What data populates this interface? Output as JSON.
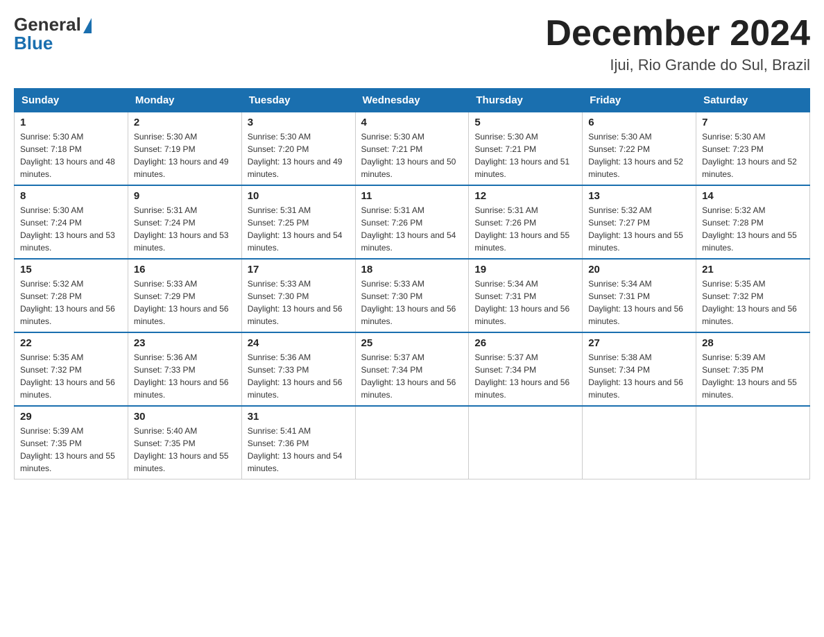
{
  "logo": {
    "general": "General",
    "blue": "Blue"
  },
  "title": "December 2024",
  "location": "Ijui, Rio Grande do Sul, Brazil",
  "headers": [
    "Sunday",
    "Monday",
    "Tuesday",
    "Wednesday",
    "Thursday",
    "Friday",
    "Saturday"
  ],
  "weeks": [
    [
      {
        "day": "1",
        "sunrise": "5:30 AM",
        "sunset": "7:18 PM",
        "daylight": "13 hours and 48 minutes."
      },
      {
        "day": "2",
        "sunrise": "5:30 AM",
        "sunset": "7:19 PM",
        "daylight": "13 hours and 49 minutes."
      },
      {
        "day": "3",
        "sunrise": "5:30 AM",
        "sunset": "7:20 PM",
        "daylight": "13 hours and 49 minutes."
      },
      {
        "day": "4",
        "sunrise": "5:30 AM",
        "sunset": "7:21 PM",
        "daylight": "13 hours and 50 minutes."
      },
      {
        "day": "5",
        "sunrise": "5:30 AM",
        "sunset": "7:21 PM",
        "daylight": "13 hours and 51 minutes."
      },
      {
        "day": "6",
        "sunrise": "5:30 AM",
        "sunset": "7:22 PM",
        "daylight": "13 hours and 52 minutes."
      },
      {
        "day": "7",
        "sunrise": "5:30 AM",
        "sunset": "7:23 PM",
        "daylight": "13 hours and 52 minutes."
      }
    ],
    [
      {
        "day": "8",
        "sunrise": "5:30 AM",
        "sunset": "7:24 PM",
        "daylight": "13 hours and 53 minutes."
      },
      {
        "day": "9",
        "sunrise": "5:31 AM",
        "sunset": "7:24 PM",
        "daylight": "13 hours and 53 minutes."
      },
      {
        "day": "10",
        "sunrise": "5:31 AM",
        "sunset": "7:25 PM",
        "daylight": "13 hours and 54 minutes."
      },
      {
        "day": "11",
        "sunrise": "5:31 AM",
        "sunset": "7:26 PM",
        "daylight": "13 hours and 54 minutes."
      },
      {
        "day": "12",
        "sunrise": "5:31 AM",
        "sunset": "7:26 PM",
        "daylight": "13 hours and 55 minutes."
      },
      {
        "day": "13",
        "sunrise": "5:32 AM",
        "sunset": "7:27 PM",
        "daylight": "13 hours and 55 minutes."
      },
      {
        "day": "14",
        "sunrise": "5:32 AM",
        "sunset": "7:28 PM",
        "daylight": "13 hours and 55 minutes."
      }
    ],
    [
      {
        "day": "15",
        "sunrise": "5:32 AM",
        "sunset": "7:28 PM",
        "daylight": "13 hours and 56 minutes."
      },
      {
        "day": "16",
        "sunrise": "5:33 AM",
        "sunset": "7:29 PM",
        "daylight": "13 hours and 56 minutes."
      },
      {
        "day": "17",
        "sunrise": "5:33 AM",
        "sunset": "7:30 PM",
        "daylight": "13 hours and 56 minutes."
      },
      {
        "day": "18",
        "sunrise": "5:33 AM",
        "sunset": "7:30 PM",
        "daylight": "13 hours and 56 minutes."
      },
      {
        "day": "19",
        "sunrise": "5:34 AM",
        "sunset": "7:31 PM",
        "daylight": "13 hours and 56 minutes."
      },
      {
        "day": "20",
        "sunrise": "5:34 AM",
        "sunset": "7:31 PM",
        "daylight": "13 hours and 56 minutes."
      },
      {
        "day": "21",
        "sunrise": "5:35 AM",
        "sunset": "7:32 PM",
        "daylight": "13 hours and 56 minutes."
      }
    ],
    [
      {
        "day": "22",
        "sunrise": "5:35 AM",
        "sunset": "7:32 PM",
        "daylight": "13 hours and 56 minutes."
      },
      {
        "day": "23",
        "sunrise": "5:36 AM",
        "sunset": "7:33 PM",
        "daylight": "13 hours and 56 minutes."
      },
      {
        "day": "24",
        "sunrise": "5:36 AM",
        "sunset": "7:33 PM",
        "daylight": "13 hours and 56 minutes."
      },
      {
        "day": "25",
        "sunrise": "5:37 AM",
        "sunset": "7:34 PM",
        "daylight": "13 hours and 56 minutes."
      },
      {
        "day": "26",
        "sunrise": "5:37 AM",
        "sunset": "7:34 PM",
        "daylight": "13 hours and 56 minutes."
      },
      {
        "day": "27",
        "sunrise": "5:38 AM",
        "sunset": "7:34 PM",
        "daylight": "13 hours and 56 minutes."
      },
      {
        "day": "28",
        "sunrise": "5:39 AM",
        "sunset": "7:35 PM",
        "daylight": "13 hours and 55 minutes."
      }
    ],
    [
      {
        "day": "29",
        "sunrise": "5:39 AM",
        "sunset": "7:35 PM",
        "daylight": "13 hours and 55 minutes."
      },
      {
        "day": "30",
        "sunrise": "5:40 AM",
        "sunset": "7:35 PM",
        "daylight": "13 hours and 55 minutes."
      },
      {
        "day": "31",
        "sunrise": "5:41 AM",
        "sunset": "7:36 PM",
        "daylight": "13 hours and 54 minutes."
      },
      null,
      null,
      null,
      null
    ]
  ]
}
